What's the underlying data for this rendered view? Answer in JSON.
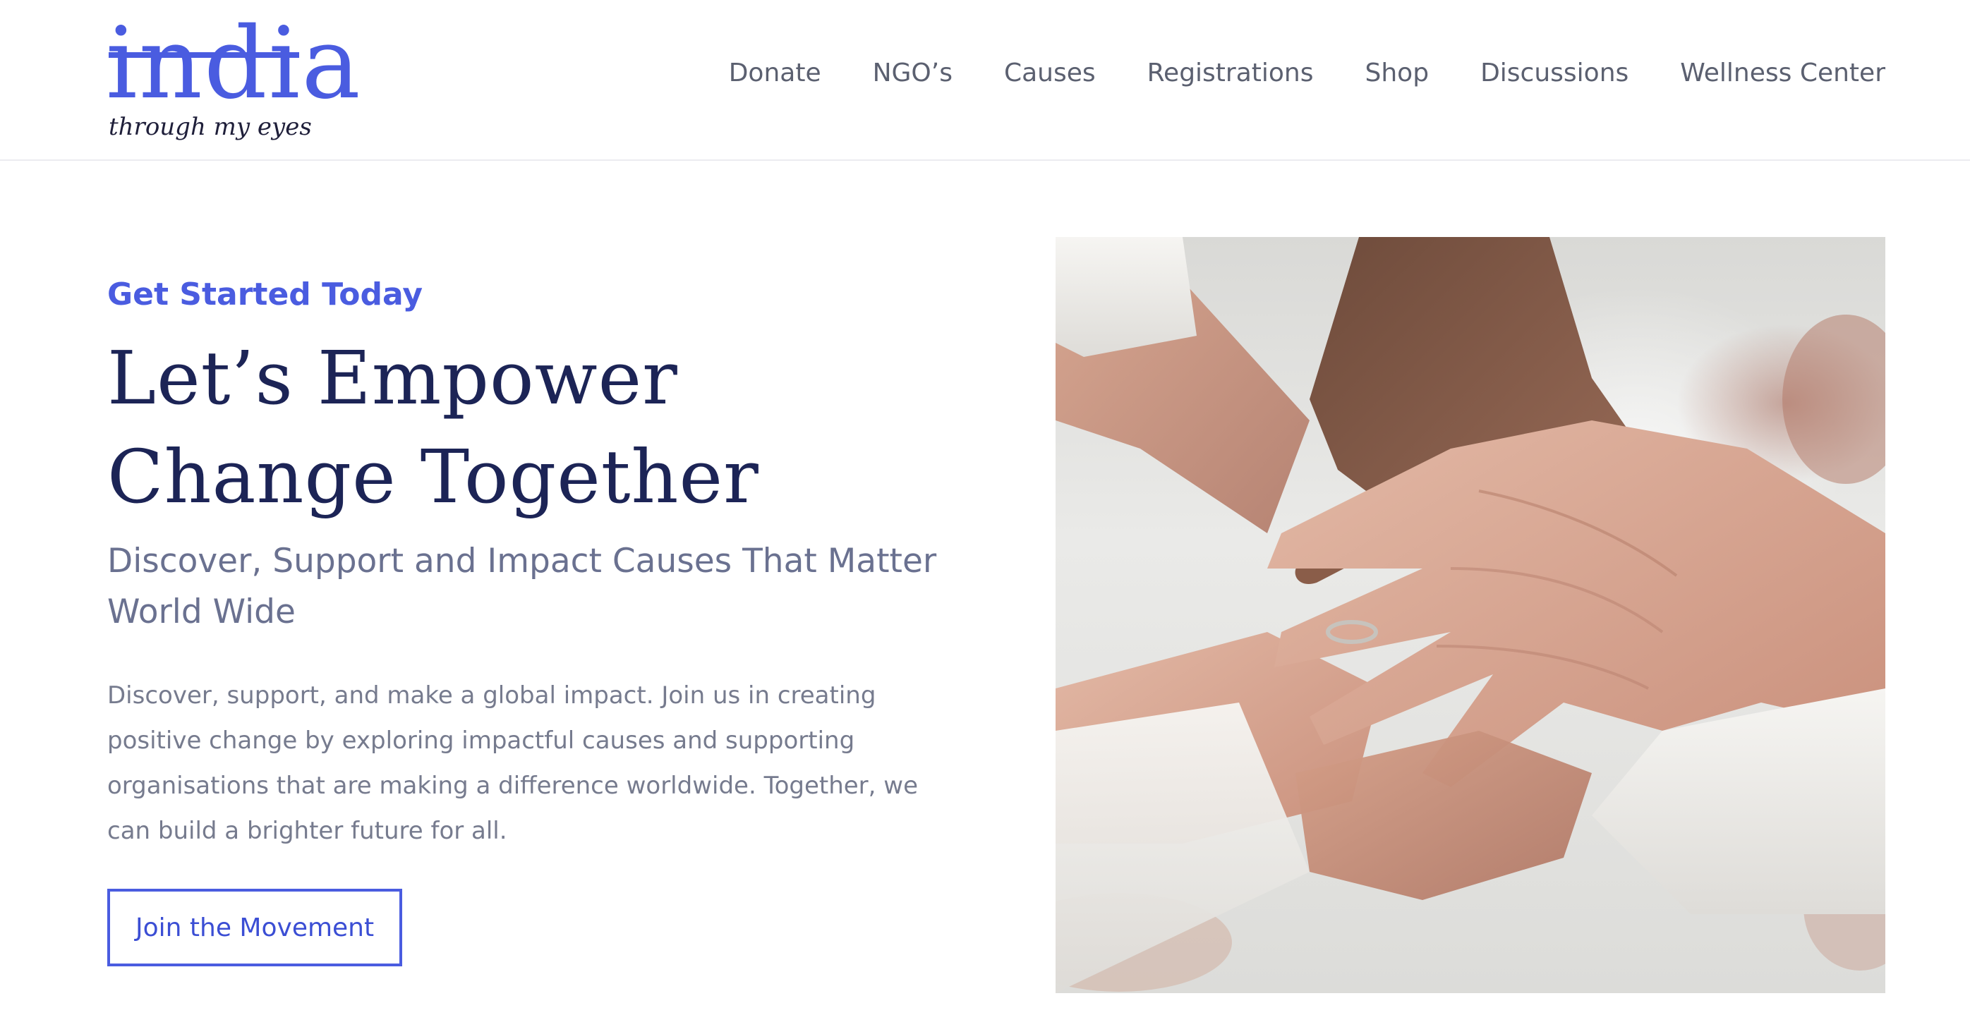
{
  "header": {
    "logo": {
      "main_text": "india",
      "sub_text": "through my eyes"
    },
    "nav": [
      {
        "label": "Donate"
      },
      {
        "label": "NGO’s"
      },
      {
        "label": "Causes"
      },
      {
        "label": "Registrations"
      },
      {
        "label": "Shop"
      },
      {
        "label": "Discussions"
      },
      {
        "label": "Wellness Center"
      }
    ]
  },
  "hero": {
    "eyebrow": "Get Started Today",
    "headline_line1": "Let’s Empower",
    "headline_line2": "Change Together",
    "subheadline": "Discover, Support and Impact Causes That Matter World Wide",
    "body": "Discover, support, and make a global impact. Join us in creating positive change by exploring impactful causes and supporting organisations that are making a difference worldwide. Together, we can build a brighter future for all.",
    "cta_label": "Join the Movement",
    "image_subject": "stacked-hands-photo"
  },
  "colors": {
    "accent": "#4a5ce0",
    "headline": "#1c2456",
    "subtext": "#6a7190",
    "nav_text": "#5b6070"
  }
}
